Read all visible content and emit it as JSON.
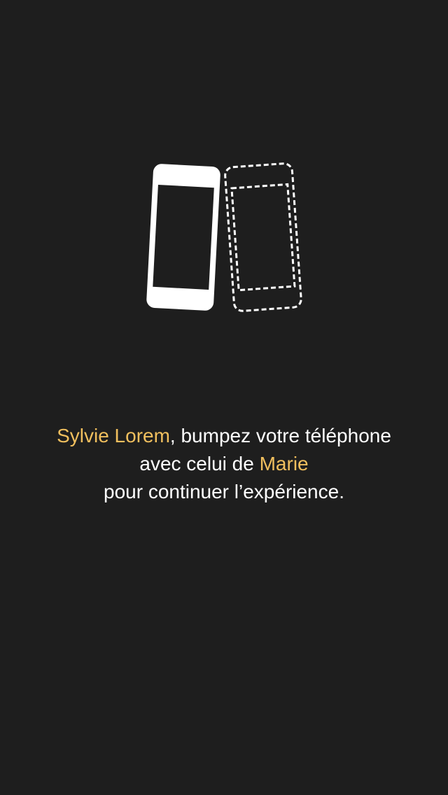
{
  "colors": {
    "background": "#1e1e1e",
    "text": "#ffffff",
    "highlight": "#f0bf5e",
    "phone": "#ffffff"
  },
  "illustration": {
    "phone_solid_icon": "phone-solid-icon",
    "phone_dashed_icon": "phone-dashed-icon"
  },
  "message": {
    "line1": {
      "user_name": "Sylvie Lorem",
      "rest": ", bumpez votre téléphone"
    },
    "line2": {
      "prefix": "avec celui de ",
      "partner_name": "Marie"
    },
    "line3": "pour continuer l’expérience."
  }
}
